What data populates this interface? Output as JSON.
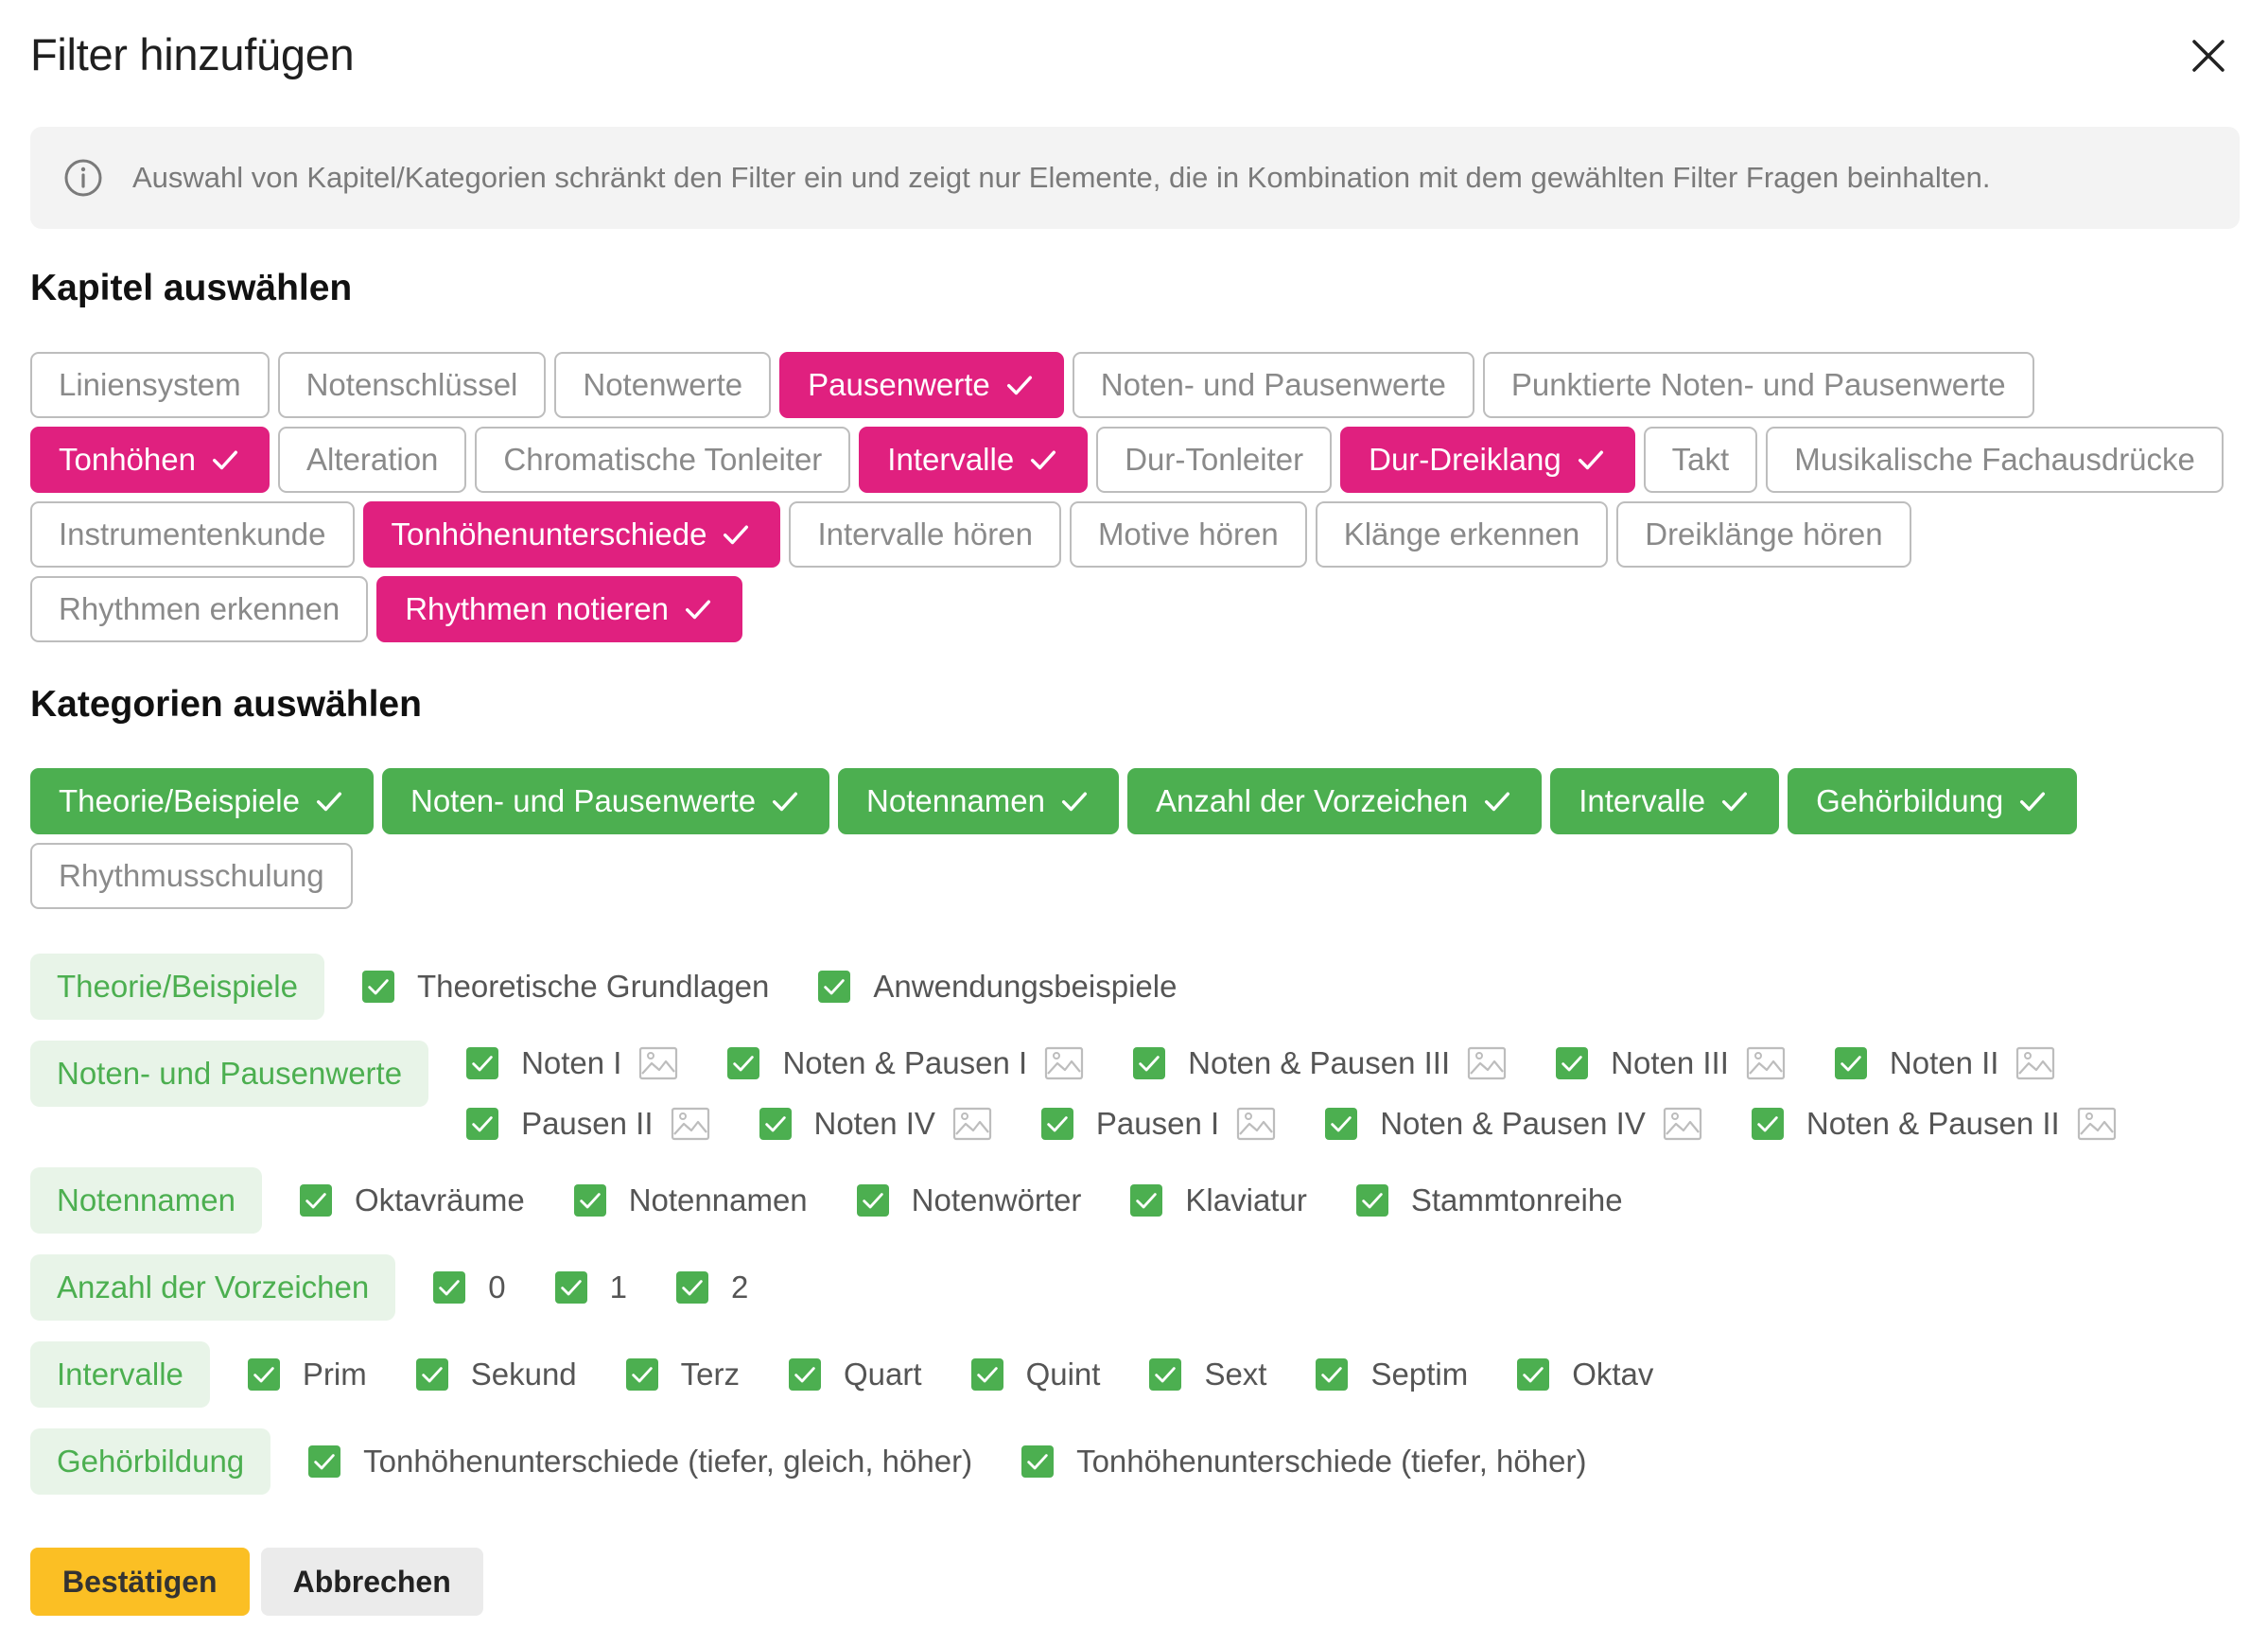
{
  "dialog": {
    "title": "Filter hinzufügen",
    "info_text": "Auswahl von Kapitel/Kategorien schränkt den Filter ein und zeigt nur Elemente, die in Kombination mit dem gewählten Filter Fragen beinhalten."
  },
  "chapters": {
    "heading": "Kapitel auswählen",
    "items": [
      {
        "label": "Liniensystem",
        "selected": false
      },
      {
        "label": "Notenschlüssel",
        "selected": false
      },
      {
        "label": "Notenwerte",
        "selected": false
      },
      {
        "label": "Pausenwerte",
        "selected": true
      },
      {
        "label": "Noten- und Pausenwerte",
        "selected": false
      },
      {
        "label": "Punktierte Noten- und Pausenwerte",
        "selected": false
      },
      {
        "label": "Tonhöhen",
        "selected": true
      },
      {
        "label": "Alteration",
        "selected": false
      },
      {
        "label": "Chromatische Tonleiter",
        "selected": false
      },
      {
        "label": "Intervalle",
        "selected": true
      },
      {
        "label": "Dur-Tonleiter",
        "selected": false
      },
      {
        "label": "Dur-Dreiklang",
        "selected": true
      },
      {
        "label": "Takt",
        "selected": false
      },
      {
        "label": "Musikalische Fachausdrücke",
        "selected": false
      },
      {
        "label": "Instrumentenkunde",
        "selected": false
      },
      {
        "label": "Tonhöhenunterschiede",
        "selected": true
      },
      {
        "label": "Intervalle hören",
        "selected": false
      },
      {
        "label": "Motive hören",
        "selected": false
      },
      {
        "label": "Klänge erkennen",
        "selected": false
      },
      {
        "label": "Dreiklänge hören",
        "selected": false
      },
      {
        "label": "Rhythmen erkennen",
        "selected": false
      },
      {
        "label": "Rhythmen notieren",
        "selected": true
      }
    ]
  },
  "categories": {
    "heading": "Kategorien auswählen",
    "items": [
      {
        "label": "Theorie/Beispiele",
        "selected": true
      },
      {
        "label": "Noten- und Pausenwerte",
        "selected": true
      },
      {
        "label": "Notennamen",
        "selected": true
      },
      {
        "label": "Anzahl der Vorzeichen",
        "selected": true
      },
      {
        "label": "Intervalle",
        "selected": true
      },
      {
        "label": "Gehörbildung",
        "selected": true
      },
      {
        "label": "Rhythmusschulung",
        "selected": false
      }
    ]
  },
  "subcategories": [
    {
      "label": "Theorie/Beispiele",
      "items": [
        {
          "label": "Theoretische Grundlagen",
          "checked": true,
          "image": false
        },
        {
          "label": "Anwendungsbeispiele",
          "checked": true,
          "image": false
        }
      ]
    },
    {
      "label": "Noten- und Pausenwerte",
      "items": [
        {
          "label": "Noten I",
          "checked": true,
          "image": true
        },
        {
          "label": "Noten & Pausen I",
          "checked": true,
          "image": true
        },
        {
          "label": "Noten & Pausen III",
          "checked": true,
          "image": true
        },
        {
          "label": "Noten III",
          "checked": true,
          "image": true
        },
        {
          "label": "Noten II",
          "checked": true,
          "image": true
        },
        {
          "label": "Pausen II",
          "checked": true,
          "image": true
        },
        {
          "label": "Noten IV",
          "checked": true,
          "image": true
        },
        {
          "label": "Pausen I",
          "checked": true,
          "image": true
        },
        {
          "label": "Noten & Pausen IV",
          "checked": true,
          "image": true
        },
        {
          "label": "Noten & Pausen II",
          "checked": true,
          "image": true
        }
      ]
    },
    {
      "label": "Notennamen",
      "items": [
        {
          "label": "Oktavräume",
          "checked": true,
          "image": false
        },
        {
          "label": "Notennamen",
          "checked": true,
          "image": false
        },
        {
          "label": "Notenwörter",
          "checked": true,
          "image": false
        },
        {
          "label": "Klaviatur",
          "checked": true,
          "image": false
        },
        {
          "label": "Stammtonreihe",
          "checked": true,
          "image": false
        }
      ]
    },
    {
      "label": "Anzahl der Vorzeichen",
      "items": [
        {
          "label": "0",
          "checked": true,
          "image": false
        },
        {
          "label": "1",
          "checked": true,
          "image": false
        },
        {
          "label": "2",
          "checked": true,
          "image": false
        }
      ]
    },
    {
      "label": "Intervalle",
      "items": [
        {
          "label": "Prim",
          "checked": true,
          "image": false
        },
        {
          "label": "Sekund",
          "checked": true,
          "image": false
        },
        {
          "label": "Terz",
          "checked": true,
          "image": false
        },
        {
          "label": "Quart",
          "checked": true,
          "image": false
        },
        {
          "label": "Quint",
          "checked": true,
          "image": false
        },
        {
          "label": "Sext",
          "checked": true,
          "image": false
        },
        {
          "label": "Septim",
          "checked": true,
          "image": false
        },
        {
          "label": "Oktav",
          "checked": true,
          "image": false
        }
      ]
    },
    {
      "label": "Gehörbildung",
      "items": [
        {
          "label": "Tonhöhenunterschiede (tiefer, gleich, höher)",
          "checked": true,
          "image": false
        },
        {
          "label": "Tonhöhenunterschiede (tiefer, höher)",
          "checked": true,
          "image": false
        }
      ]
    }
  ],
  "footer": {
    "confirm_label": "Bestätigen",
    "cancel_label": "Abbrechen"
  },
  "colors": {
    "chapter_selected": "#e0207f",
    "category_selected": "#4caf50",
    "confirm_button": "#fbbf24"
  }
}
